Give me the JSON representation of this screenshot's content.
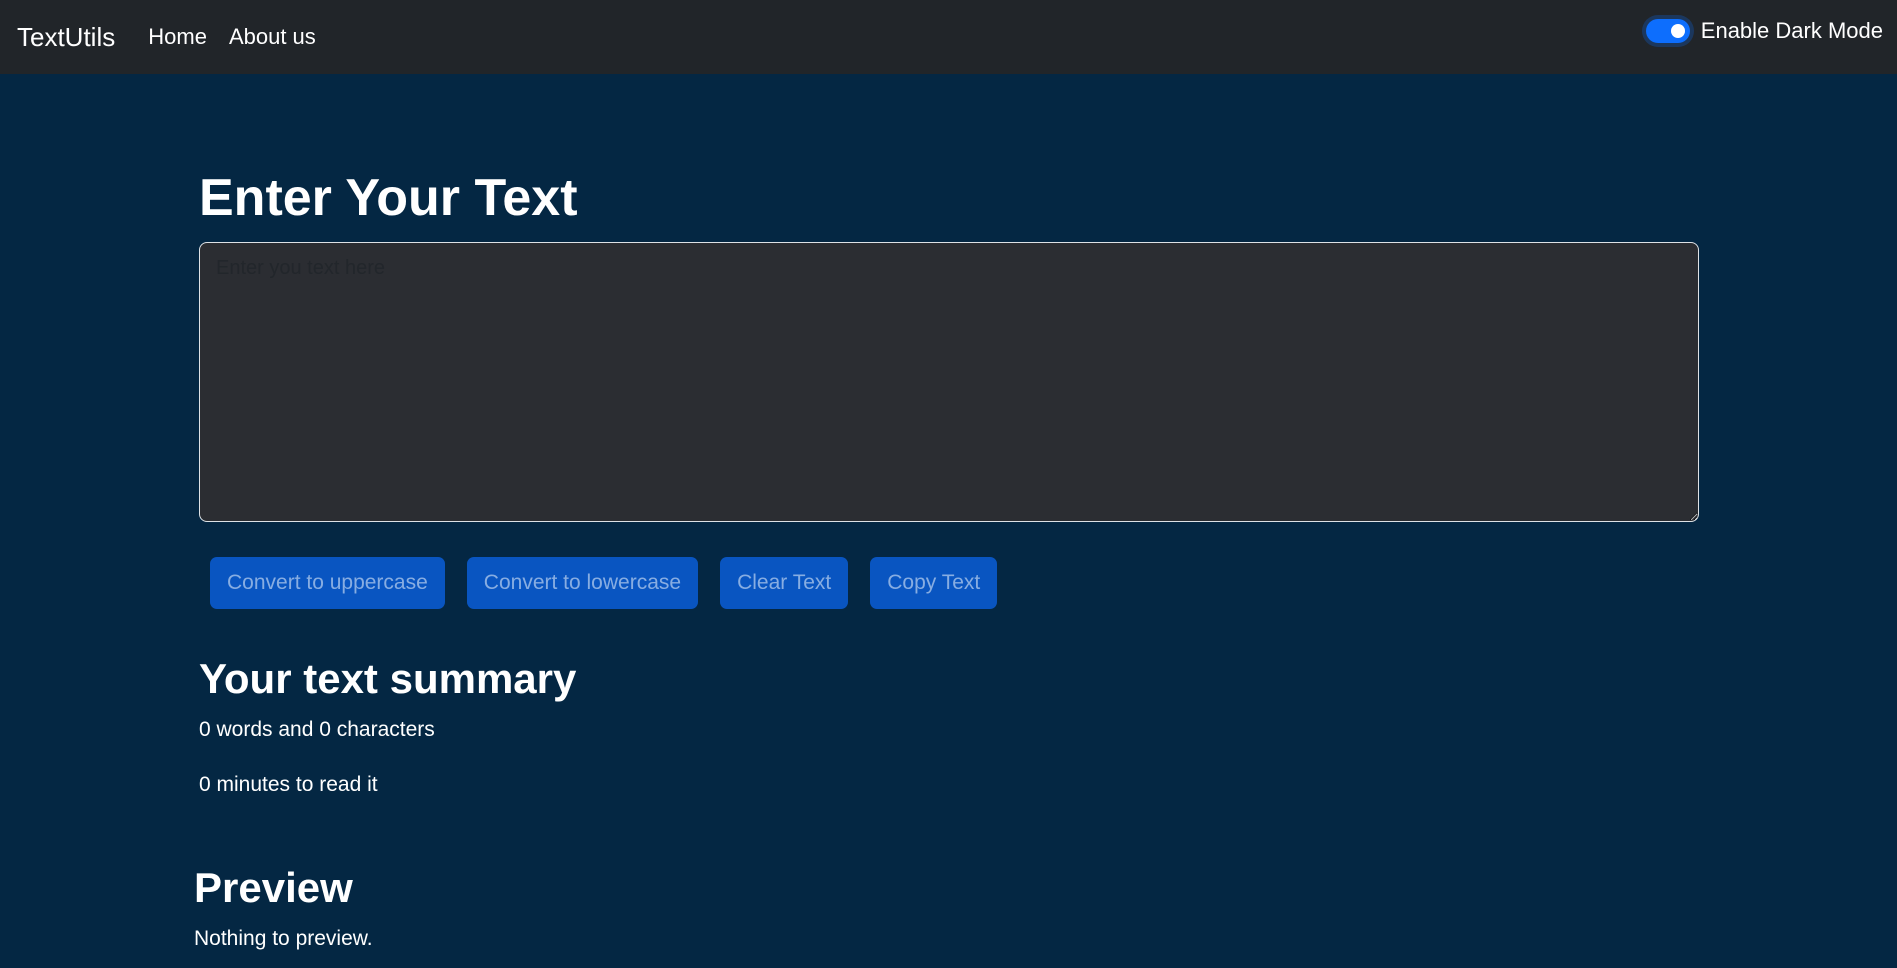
{
  "navbar": {
    "brand": "TextUtils",
    "links": [
      "Home",
      "About us"
    ],
    "dark_mode_label": "Enable Dark Mode",
    "dark_mode_enabled": true
  },
  "main": {
    "heading": "Enter Your Text",
    "textarea": {
      "value": "",
      "placeholder": "Enter you text here"
    },
    "buttons": {
      "uppercase": "Convert to uppercase",
      "lowercase": "Convert to lowercase",
      "clear": "Clear Text",
      "copy": "Copy Text"
    }
  },
  "summary": {
    "title": "Your text summary",
    "words_chars": "0 words and 0 characters",
    "read_time": "0 minutes to read it"
  },
  "preview": {
    "title": "Preview",
    "text": "Nothing to preview."
  },
  "colors": {
    "page_bg": "#042743",
    "navbar_bg": "#212529",
    "accent": "#0d6efd",
    "textarea_bg": "#2b2d32"
  }
}
